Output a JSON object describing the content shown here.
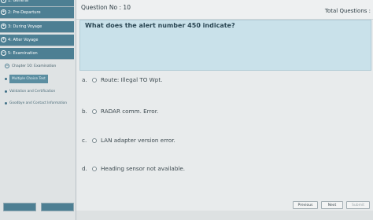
{
  "sidebar": {
    "sections": [
      {
        "num": "1",
        "label": "1: General"
      },
      {
        "num": "2",
        "label": "2: Pre-Departure"
      },
      {
        "num": "3",
        "label": "3: During Voyage"
      },
      {
        "num": "4",
        "label": "4: After Voyage"
      },
      {
        "num": "5",
        "label": "5: Examination"
      }
    ],
    "chapter": {
      "label": "Chapter 10: Examination"
    },
    "leaves": [
      {
        "label": "Multiple Choice Test"
      },
      {
        "label": "Validation and Certification"
      },
      {
        "label": "Goodbye and Contact Information"
      }
    ]
  },
  "header": {
    "question_no": "Question No : 10",
    "total_questions": "Total Questions :"
  },
  "question": {
    "text": "What does the alert number 450 indicate?"
  },
  "options": [
    {
      "letter": "a.",
      "text": "Route: Illegal TO Wpt."
    },
    {
      "letter": "b.",
      "text": "RADAR comm. Error."
    },
    {
      "letter": "c.",
      "text": "LAN adapter version error."
    },
    {
      "letter": "d.",
      "text": "Heading sensor not available."
    }
  ],
  "footer": {
    "previous": "Previous",
    "next": "Next",
    "submit": "Submit"
  }
}
